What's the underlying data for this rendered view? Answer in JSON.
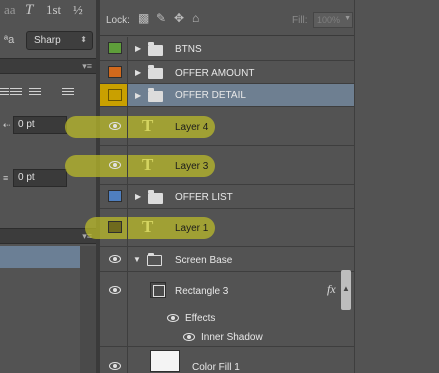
{
  "character_panel": {
    "top_glyphs": [
      "aa",
      "T",
      "1st",
      "½"
    ],
    "antialias_icon": "aa-icon",
    "antialias_value": "Sharp",
    "indent_left_value": "0 pt",
    "space_before_value": "0 pt"
  },
  "layers_panel": {
    "lock_label": "Lock:",
    "fill_label": "Fill:",
    "fill_value": "100%",
    "layers": [
      {
        "name": "BTNS",
        "kind": "group",
        "swatch": "#5e9e3a"
      },
      {
        "name": "OFFER AMOUNT",
        "kind": "group",
        "swatch": "#d1691c"
      },
      {
        "name": "OFFER DETAIL",
        "kind": "group",
        "swatch": "#c9a000",
        "selected": true
      },
      {
        "name": "Layer 4",
        "kind": "text",
        "visible": true,
        "highlighted": true
      },
      {
        "name": "Layer 3",
        "kind": "text",
        "visible": true,
        "highlighted": true
      },
      {
        "name": "OFFER LIST",
        "kind": "group",
        "swatch": "#4f7fbf"
      },
      {
        "name": "Layer 1",
        "kind": "text",
        "swatch": "#6f6a1e",
        "highlighted": true
      },
      {
        "name": "Screen Base",
        "kind": "group-open",
        "visible": true
      },
      {
        "name": "Rectangle 3",
        "kind": "shape",
        "visible": true,
        "fx": "fx"
      },
      {
        "name": "Effects",
        "kind": "effects",
        "visible": true
      },
      {
        "name": "Inner Shadow",
        "kind": "effect",
        "visible": true
      },
      {
        "name": "Color Fill 1",
        "kind": "fill",
        "visible": true
      }
    ]
  },
  "colors": {
    "highlight": "#c4c428",
    "selected_row": "#6e7f91",
    "panel_bg": "#535353"
  }
}
